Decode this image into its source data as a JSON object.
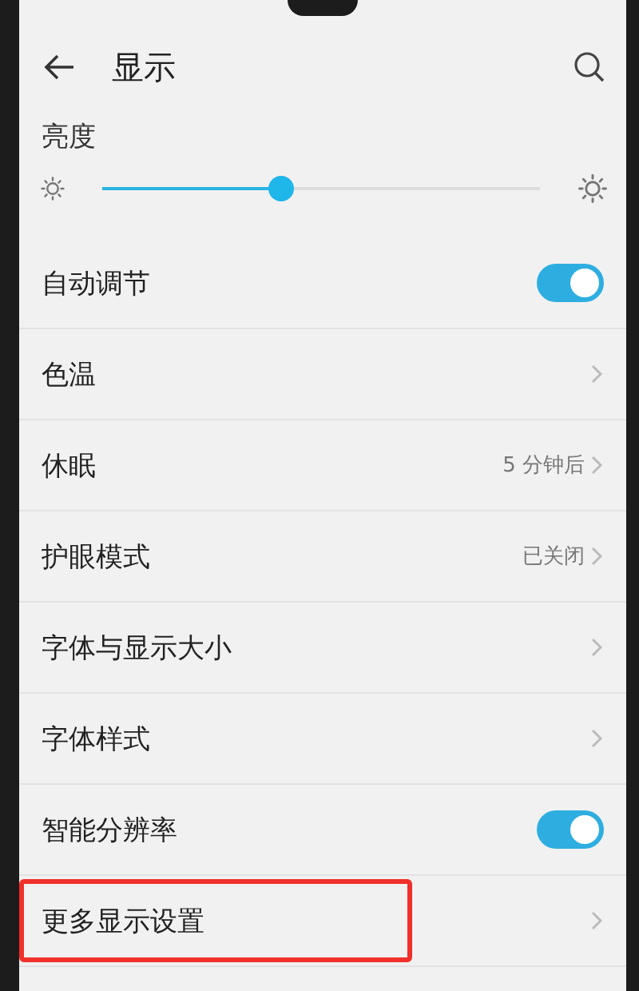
{
  "header": {
    "title": "显示"
  },
  "brightness": {
    "label": "亮度",
    "level": 0.41
  },
  "settings": [
    {
      "kind": "toggle",
      "label": "自动调节",
      "on": true,
      "highlighted": false
    },
    {
      "kind": "link",
      "label": "色温",
      "highlighted": false
    },
    {
      "kind": "link",
      "label": "休眠",
      "value": "5 分钟后",
      "highlighted": false
    },
    {
      "kind": "link",
      "label": "护眼模式",
      "value": "已关闭",
      "highlighted": false
    },
    {
      "kind": "link",
      "label": "字体与显示大小",
      "highlighted": false
    },
    {
      "kind": "link",
      "label": "字体样式",
      "highlighted": false
    },
    {
      "kind": "toggle",
      "label": "智能分辨率",
      "on": true,
      "highlighted": false
    },
    {
      "kind": "link",
      "label": "更多显示设置",
      "highlighted": true
    }
  ]
}
